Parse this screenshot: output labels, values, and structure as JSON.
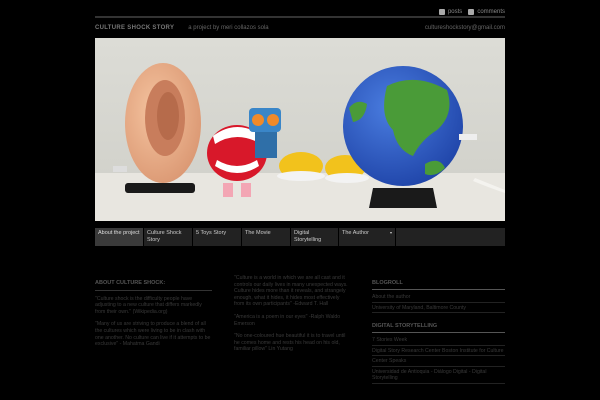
{
  "topbar": {
    "posts": "posts",
    "comments": "comments"
  },
  "header": {
    "site_title": "CULTURE SHOCK STORY",
    "tagline": "a project by meri collazos sola",
    "email": "cultureshockstory@gmail.com"
  },
  "hero": {
    "alt": "Wind-up toys: ear, chattering teeth, robot, shoes and a globe"
  },
  "nav": {
    "items": [
      {
        "label": "About the project"
      },
      {
        "label": "Culture Shock Story"
      },
      {
        "label": "5 Toys Story"
      },
      {
        "label": "The Movie"
      },
      {
        "label": "Digital Storytelling"
      },
      {
        "label": "The Author"
      }
    ]
  },
  "left": {
    "heading": "ABOUT CULTURE SHOCK:",
    "p1": "\"Culture shock is the difficulty people have adjusting to a new culture that differs markedly from their own.\" (Wikipedia.org)",
    "p2": "\"Many of us are striving to produce a blend of all the cultures which were living to be in clash with one another. No culture can live if it attempts to be exclusive\" - Mahatma Gandi"
  },
  "mid": {
    "p1": "\"Culture is a world in which we are all cast and it controls our daily lives in many unexpected ways. Culture hides more than it reveals, and strangely enough, what it hides, it hides most effectively from its own participants\" -Edward T. Hall",
    "p2": "\"America is a poem in our eyes\" -Ralph Waldo Emerson",
    "p3": "\"No one-coloured hue beautiful it is to travel until he comes home and rests his head on his old, familiar pillow\" Lin Yutang"
  },
  "right": {
    "blogroll_heading": "BLOGROLL",
    "blogroll": [
      "About the author",
      "University of Maryland, Baltimore County"
    ],
    "ds_heading": "DIGITAL STORYTELLING",
    "ds_links": [
      "7 Stories Week",
      "Digital Story Research Center Boston Institute for Culture",
      "Center Speaks",
      "Universidad de Antioquia - Diálogo Digital - Digital Storytelling"
    ]
  }
}
